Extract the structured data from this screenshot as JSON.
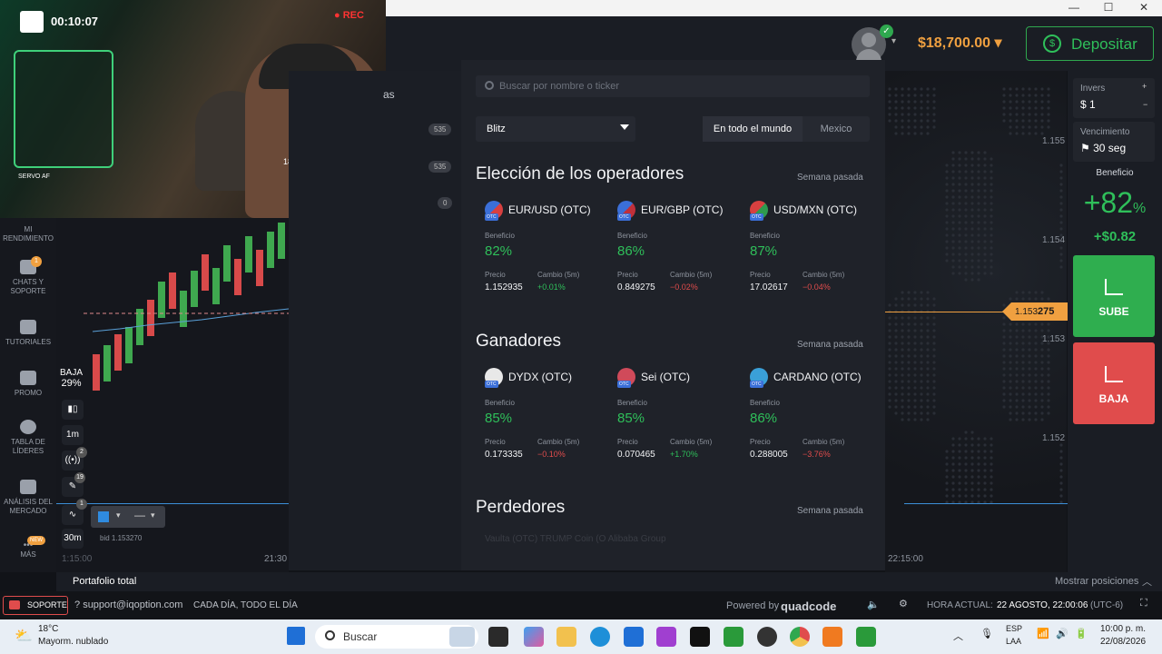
{
  "webcam": {
    "time": "00:10:07",
    "rec": "REC",
    "label_zoom": "18mm",
    "label_device": "SERVO AF"
  },
  "header": {
    "balance": "$18,700.00 ▾",
    "deposit_label": "Depositar",
    "deposit_icon": "$"
  },
  "window_controls": {
    "minimize": "—",
    "maximize": "☐",
    "close": "✕"
  },
  "sidebar": {
    "items": [
      {
        "label": "MI RENDIMIENTO"
      },
      {
        "label": "CHATS Y SOPORTE",
        "badge": "1"
      },
      {
        "label": "TUTORIALES"
      },
      {
        "label": "PROMO"
      },
      {
        "label": "TABLA DE LÍDERES"
      },
      {
        "label": "ANÁLISIS DEL MERCADO"
      },
      {
        "label": "MÁS",
        "badge": "NEW"
      }
    ]
  },
  "chart_tools": {
    "baja_label": "BAJA",
    "baja_pct": "29%",
    "timeframe": "1m",
    "badge_signals": "2",
    "badge_draw": "19",
    "badge_indicators": "1",
    "period": "30m",
    "bid": "bid 1.153270",
    "time_left": "21:30",
    "time_right": "22:15:00",
    "time_faint": "1:15:00"
  },
  "axis": {
    "ticks": [
      "1.155",
      "1.154",
      "1.153",
      "1.152"
    ],
    "price_prefix": "1.153",
    "price_suffix": "275"
  },
  "middle_panel": {
    "badges": [
      "535",
      "535",
      "0"
    ],
    "partial_text": "as"
  },
  "modal": {
    "search_placeholder": "Buscar por nombre o ticker",
    "filter_value": "Blitz",
    "region_tabs": [
      "En todo el mundo",
      "Mexico"
    ],
    "sections": [
      {
        "title": "Elección de los operadores",
        "period": "Semana pasada",
        "cards": [
          {
            "name": "EUR/USD (OTC)",
            "benefit_label": "Beneficio",
            "benefit": "82%",
            "price_label": "Precio",
            "change_label": "Cambio (5m)",
            "price": "1.152935",
            "change": "+0.01%",
            "dir": "up"
          },
          {
            "name": "EUR/GBP (OTC)",
            "benefit_label": "Beneficio",
            "benefit": "86%",
            "price_label": "Precio",
            "change_label": "Cambio (5m)",
            "price": "0.849275",
            "change": "−0.02%",
            "dir": "down"
          },
          {
            "name": "USD/MXN (OTC)",
            "benefit_label": "Beneficio",
            "benefit": "87%",
            "price_label": "Precio",
            "change_label": "Cambio (5m)",
            "price": "17.02617",
            "change": "−0.04%",
            "dir": "down"
          }
        ]
      },
      {
        "title": "Ganadores",
        "period": "Semana pasada",
        "cards": [
          {
            "name": "DYDX (OTC)",
            "benefit_label": "Beneficio",
            "benefit": "85%",
            "price_label": "Precio",
            "change_label": "Cambio (5m)",
            "price": "0.173335",
            "change": "−0.10%",
            "dir": "down"
          },
          {
            "name": "Sei (OTC)",
            "benefit_label": "Beneficio",
            "benefit": "85%",
            "price_label": "Precio",
            "change_label": "Cambio (5m)",
            "price": "0.070465",
            "change": "+1.70%",
            "dir": "up"
          },
          {
            "name": "CARDANO (OTC)",
            "benefit_label": "Beneficio",
            "benefit": "86%",
            "price_label": "Precio",
            "change_label": "Cambio (5m)",
            "price": "0.288005",
            "change": "−3.76%",
            "dir": "down"
          }
        ]
      },
      {
        "title": "Perdedores",
        "period": "Semana pasada",
        "cards": []
      }
    ],
    "faded_row": "Vaulta (OTC)          TRUMP Coin (O          Alibaba Group"
  },
  "right_panel": {
    "invest_label": "Invers",
    "invest_value": "$ 1",
    "expiry_label": "Vencimiento",
    "expiry_value": "30 seg",
    "profit_label": "Beneficio",
    "profit_pct": "+82",
    "profit_pct_sign": "%",
    "profit_amount": "+$0.82",
    "up_label": "SUBE",
    "down_label": "BAJA"
  },
  "portfolio": {
    "label": "Portafolio total",
    "show_positions": "Mostrar posiciones"
  },
  "statusbar": {
    "support_label": "SOPORTE",
    "support_email": "support@iqoption.com",
    "hours": "CADA DÍA, TODO EL DÍA",
    "powered": "Powered by",
    "brand": "quadcode",
    "time_label": "HORA ACTUAL:",
    "time_value": "22 AGOSTO, 22:00:06",
    "timezone": "(UTC-6)"
  },
  "taskbar": {
    "weather_temp": "18°C",
    "weather_desc": "Mayorm. nublado",
    "search_placeholder": "Buscar",
    "lang": "ESP",
    "lang_sub": "LAA",
    "clock_time": "10:00 p. m.",
    "clock_date": "22/08/2026"
  },
  "colors": {
    "green": "#2fbf5a",
    "red": "#e04c4c",
    "orange": "#f0a040"
  }
}
